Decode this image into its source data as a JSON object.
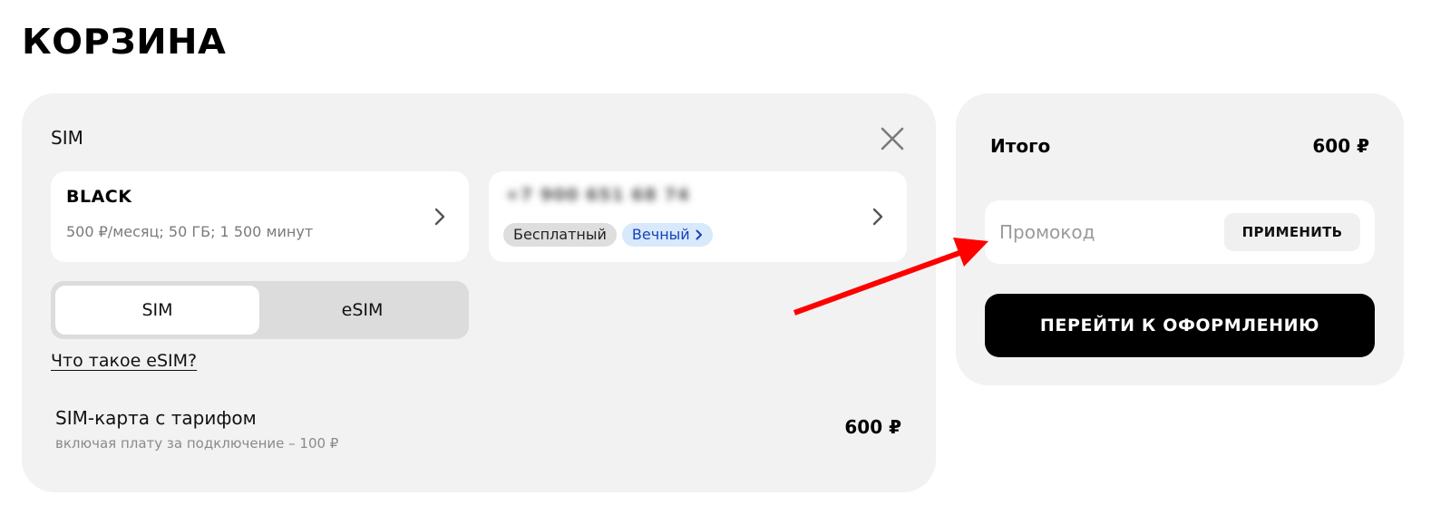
{
  "page": {
    "title": "КОРЗИНА"
  },
  "cart": {
    "section_title": "SIM",
    "tariff": {
      "name": "BLACK",
      "description": "500 ₽/месяц; 50 ГБ; 1 500 минут"
    },
    "number": {
      "value": "+7 900 651 68 74",
      "badges": [
        {
          "label": "Бесплатный"
        },
        {
          "label": "Вечный"
        }
      ]
    },
    "sim_type": {
      "options": [
        "SIM",
        "eSIM"
      ],
      "selected": "SIM"
    },
    "esim_link": "Что такое eSIM?",
    "line_item": {
      "name": "SIM-карта с тарифом",
      "subtitle": "включая плату за подключение – 100 ₽",
      "price": "600 ₽"
    }
  },
  "summary": {
    "total_label": "Итого",
    "total_value": "600 ₽",
    "promo": {
      "placeholder": "Промокод",
      "value": "",
      "apply_label": "ПРИМЕНИТЬ"
    },
    "checkout_label": "ПЕРЕЙТИ К ОФОРМЛЕНИЮ"
  },
  "colors": {
    "card_bg": "#f2f2f2",
    "badge_blue_bg": "#d7e9fb",
    "badge_blue_text": "#1a3fb8",
    "annotation_arrow": "#ff0000"
  }
}
